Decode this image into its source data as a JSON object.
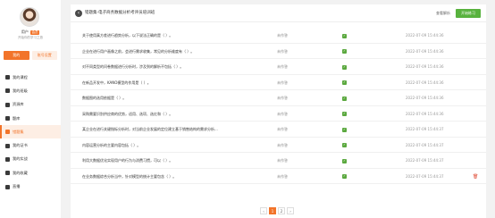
{
  "user": {
    "name": "用户",
    "badge": "会员",
    "subtitle": "开始你的学习之旅"
  },
  "sidebar": {
    "primary_button": "我的",
    "secondary_button": "账号设置",
    "items": [
      {
        "label": "我的课程",
        "icon": "course-icon"
      },
      {
        "label": "我的班级",
        "icon": "class-icon"
      },
      {
        "label": "资源库",
        "icon": "resource-icon"
      },
      {
        "label": "题库",
        "icon": "question-bank-icon"
      },
      {
        "label": "错题集",
        "icon": "wrong-questions-icon",
        "active": true
      },
      {
        "label": "我的证书",
        "icon": "certificate-icon"
      },
      {
        "label": "我的实战",
        "icon": "practice-icon"
      },
      {
        "label": "我的收藏",
        "icon": "favorite-icon"
      },
      {
        "label": "直播",
        "icon": "live-icon"
      }
    ]
  },
  "header": {
    "title": "错题集-电子商务数据分析考评员培训班",
    "link": "查看解析",
    "button": "开始练习"
  },
  "rows": [
    {
      "question": "关于使用真方差进行趋势分析，以下说法正确的是（ ）。",
      "status": "未作答",
      "date": "2022-07-09 15:44:36"
    },
    {
      "question": "企业在进行用户画像之前，会进行需求收集，常见的分析维度有（ ）。",
      "status": "未作答",
      "date": "2022-07-09 15:44:36"
    },
    {
      "question": "对不同类型的问卷数据进行分析时，涉及到的解析不包括（ ）。",
      "status": "未作答",
      "date": "2022-07-09 15:44:36"
    },
    {
      "question": "在新品开发中，KANO模型的作用是（ ）。",
      "status": "未作答",
      "date": "2022-07-09 15:44:36"
    },
    {
      "question": "数据图的选用依据是（ ）。",
      "status": "未作答",
      "date": "2022-07-09 15:44:36"
    },
    {
      "question": "采购需要识别供应商的优势，适用、选项、选红和（ ）。",
      "status": "未作答",
      "date": "2022-07-09 15:44:36"
    },
    {
      "question": "某企业在进行关键指标分析时，对当前企业发展的定位建立基于销售结构的需求分析...",
      "status": "未作答",
      "date": "2022-07-09 15:44:37"
    },
    {
      "question": "内容运营分析的主要内容包括（ ）。",
      "status": "未作答",
      "date": "2022-07-09 15:44:37"
    },
    {
      "question": "利用大数据优化实现用户的行为与消费习惯，可以（ ）。",
      "status": "未作答",
      "date": "2022-07-09 15:44:37"
    },
    {
      "question": "在业务数据综合分析当中，针对模型的统计主要包含（ ）。",
      "status": "未作答",
      "date": "2022-07-09 15:44:37"
    }
  ],
  "pagination": {
    "prev": "‹",
    "pages": [
      "1",
      "2"
    ],
    "next": "›"
  }
}
